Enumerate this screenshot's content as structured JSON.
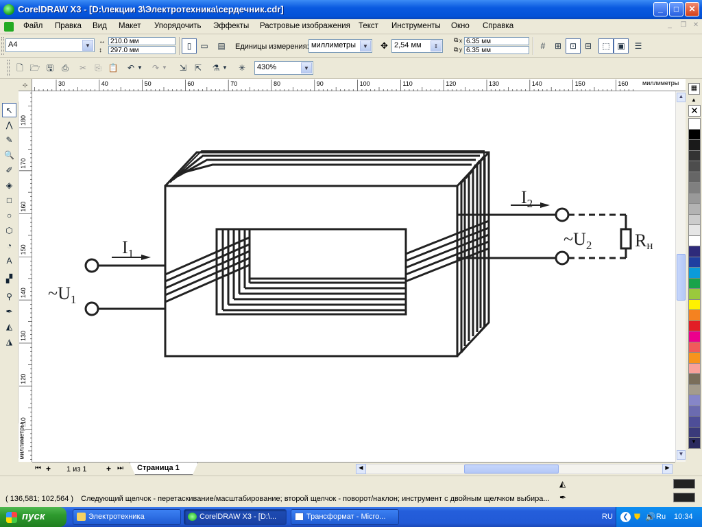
{
  "window": {
    "title": "CorelDRAW X3 - [D:\\лекции 3\\Электротехника\\сердечник.cdr]",
    "controls": {
      "minimize": "_",
      "maximize": "□",
      "close": "✕"
    }
  },
  "menu": {
    "items": [
      "Файл",
      "Правка",
      "Вид",
      "Макет",
      "Упорядочить",
      "Эффекты",
      "Растровые изображения",
      "Текст",
      "Инструменты",
      "Окно",
      "Справка"
    ]
  },
  "property_bar": {
    "paper_size": "A4",
    "width": "210.0 мм",
    "height": "297.0 мм",
    "units_label": "Единицы измерения:",
    "units_value": "миллиметры",
    "nudge": "2,54 мм",
    "dup_x": "6.35 мм",
    "dup_y": "6.35 мм",
    "dup_x_label": "x",
    "dup_y_label": "y"
  },
  "standard_bar": {
    "zoom": "430%"
  },
  "rulers": {
    "h_ticks": [
      "30",
      "40",
      "50",
      "60",
      "70",
      "80",
      "90",
      "100",
      "110",
      "120",
      "130",
      "140",
      "150",
      "160"
    ],
    "h_unit": "миллиметры",
    "v_ticks": [
      "180",
      "170",
      "160",
      "150",
      "140",
      "130",
      "120",
      "110"
    ],
    "v_unit": "миллиметры"
  },
  "diagram": {
    "I1_base": "I",
    "I1_sub": "1",
    "U1_tilde": "~",
    "U1_base": "U",
    "U1_sub": "1",
    "I2_base": "I",
    "I2_sub": "2",
    "U2_tilde": "~",
    "U2_base": "U",
    "U2_sub": "2",
    "R_base": "R",
    "R_sub": "н"
  },
  "page_nav": {
    "counter": "1 из 1",
    "tab": "Страница 1"
  },
  "status": {
    "coords": "( 136,581; 102,564 )",
    "message": "Следующий щелчок - перетаскивание/масштабирование; второй щелчок - поворот/наклон; инструмент с двойным щелчком выбира..."
  },
  "palette": {
    "colors": [
      "#ffffff",
      "#000000",
      "#1a1a1a",
      "#333333",
      "#4d4d4d",
      "#666666",
      "#808080",
      "#999999",
      "#b3b3b3",
      "#cccccc",
      "#e6e6e6",
      "#ffffff",
      "#2e2a7a",
      "#1f3fa0",
      "#0a9bd9",
      "#1aa34a",
      "#9ac93c",
      "#fff200",
      "#f58220",
      "#e21e26",
      "#ec008c",
      "#f15a5a",
      "#f7941d",
      "#f9a19a",
      "#7a6e5a",
      "#a49c8c",
      "#8686c8",
      "#6b6bb0",
      "#4e4e98",
      "#3a3a7a",
      "#2a2a5e"
    ]
  },
  "taskbar": {
    "start": "пуск",
    "tasks": [
      "Электротехника",
      "CorelDRAW X3 - [D:\\...",
      "Трансформат - Micro..."
    ],
    "lang": "RU",
    "tray_lang": "Ru",
    "clock": "10:34"
  }
}
